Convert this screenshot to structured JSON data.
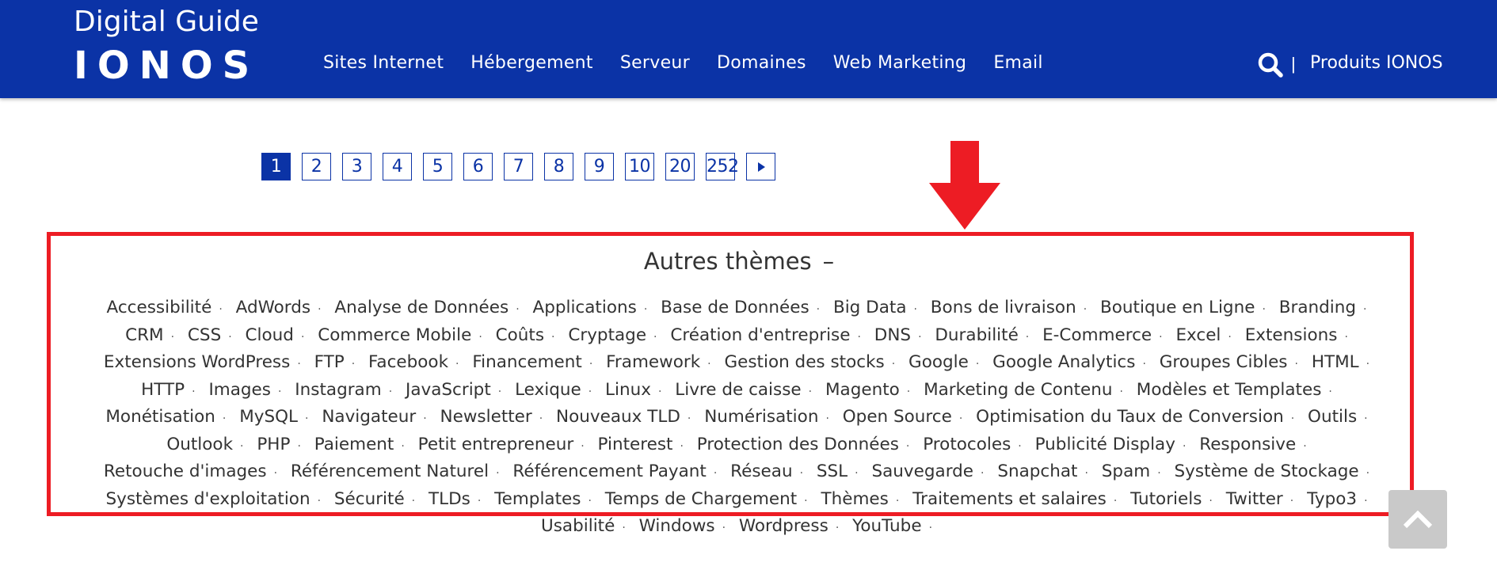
{
  "header": {
    "brand_title": "Digital Guide",
    "brand_logo": "IONOS",
    "nav": [
      "Sites Internet",
      "Hébergement",
      "Serveur",
      "Domaines",
      "Web Marketing",
      "Email"
    ],
    "search_icon": "search-icon",
    "separator": "|",
    "products_link": "Produits IONOS",
    "background_color": "#0b33a6"
  },
  "pagination": {
    "pages": [
      "1",
      "2",
      "3",
      "4",
      "5",
      "6",
      "7",
      "8",
      "9",
      "10",
      "20",
      "252"
    ],
    "active_page": "1",
    "next_icon": "caret-right-icon"
  },
  "annotation": {
    "arrow_color": "#ed1c24",
    "box_color": "#ed1c24"
  },
  "themes": {
    "title": "Autres thèmes",
    "collapse_symbol": "–",
    "separator": "·",
    "items": [
      "Accessibilité",
      "AdWords",
      "Analyse de Données",
      "Applications",
      "Base de Données",
      "Big Data",
      "Bons de livraison",
      "Boutique en Ligne",
      "Branding",
      "CRM",
      "CSS",
      "Cloud",
      "Commerce Mobile",
      "Coûts",
      "Cryptage",
      "Création d'entreprise",
      "DNS",
      "Durabilité",
      "E-Commerce",
      "Excel",
      "Extensions",
      "Extensions WordPress",
      "FTP",
      "Facebook",
      "Financement",
      "Framework",
      "Gestion des stocks",
      "Google",
      "Google Analytics",
      "Groupes Cibles",
      "HTML",
      "HTTP",
      "Images",
      "Instagram",
      "JavaScript",
      "Lexique",
      "Linux",
      "Livre de caisse",
      "Magento",
      "Marketing de Contenu",
      "Modèles et Templates",
      "Monétisation",
      "MySQL",
      "Navigateur",
      "Newsletter",
      "Nouveaux TLD",
      "Numérisation",
      "Open Source",
      "Optimisation du Taux de Conversion",
      "Outils",
      "Outlook",
      "PHP",
      "Paiement",
      "Petit entrepreneur",
      "Pinterest",
      "Protection des Données",
      "Protocoles",
      "Publicité Display",
      "Responsive",
      "Retouche d'images",
      "Référencement Naturel",
      "Référencement Payant",
      "Réseau",
      "SSL",
      "Sauvegarde",
      "Snapchat",
      "Spam",
      "Système de Stockage",
      "Systèmes d'exploitation",
      "Sécurité",
      "TLDs",
      "Templates",
      "Temps de Chargement",
      "Thèmes",
      "Traitements et salaires",
      "Tutoriels",
      "Twitter",
      "Typo3",
      "Usabilité",
      "Windows",
      "Wordpress",
      "YouTube"
    ]
  },
  "scroll_top": {
    "icon": "chevron-up-icon"
  }
}
